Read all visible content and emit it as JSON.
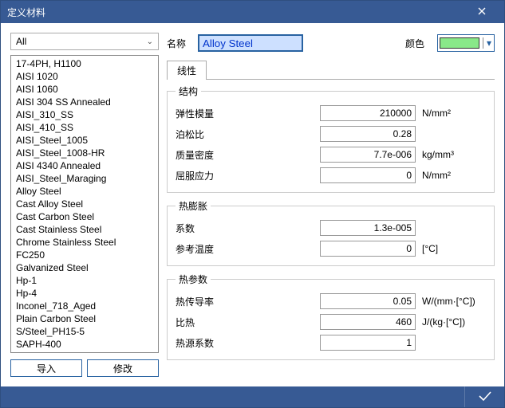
{
  "window": {
    "title": "定义材料"
  },
  "filter": {
    "value": "All"
  },
  "materials": [
    "17-4PH, H1100",
    "AISI 1020",
    "AISI 1060",
    "AISI 304 SS Annealed",
    "AISI_310_SS",
    "AISI_410_SS",
    "AISI_Steel_1005",
    "AISI_Steel_1008-HR",
    "AISI 4340 Annealed",
    "AISI_Steel_Maraging",
    "Alloy Steel",
    "Cast Alloy Steel",
    "Cast Carbon Steel",
    "Cast Stainless Steel",
    "Chrome Stainless Steel",
    "FC250",
    "Galvanized Steel",
    "Hp-1",
    "Hp-4",
    "Inconel_718_Aged",
    "Plain Carbon Steel",
    "S/Steel_PH15-5",
    "SAPH-400"
  ],
  "buttons": {
    "import": "导入",
    "modify": "修改"
  },
  "labels": {
    "name": "名称",
    "color": "颜色"
  },
  "name_value": "Alloy Steel",
  "color_value": "#89e889",
  "tabs": {
    "linear": "线性"
  },
  "groups": {
    "structure": {
      "legend": "结构",
      "elastic_modulus": {
        "label": "弹性模量",
        "value": "210000",
        "unit": "N/mm²"
      },
      "poisson": {
        "label": "泊松比",
        "value": "0.28",
        "unit": ""
      },
      "mass_density": {
        "label": "质量密度",
        "value": "7.7e-006",
        "unit": "kg/mm³"
      },
      "yield_stress": {
        "label": "屈服应力",
        "value": "0",
        "unit": "N/mm²"
      }
    },
    "thermal_exp": {
      "legend": "热膨胀",
      "coefficient": {
        "label": "系数",
        "value": "1.3e-005",
        "unit": ""
      },
      "ref_temp": {
        "label": "参考温度",
        "value": "0",
        "unit": "[°C]"
      }
    },
    "thermal_param": {
      "legend": "热参数",
      "conductivity": {
        "label": "热传导率",
        "value": "0.05",
        "unit": "W/(mm·[°C])"
      },
      "specific_heat": {
        "label": "比热",
        "value": "460",
        "unit": "J/(kg·[°C])"
      },
      "heat_source_coef": {
        "label": "热源系数",
        "value": "1",
        "unit": ""
      }
    }
  }
}
